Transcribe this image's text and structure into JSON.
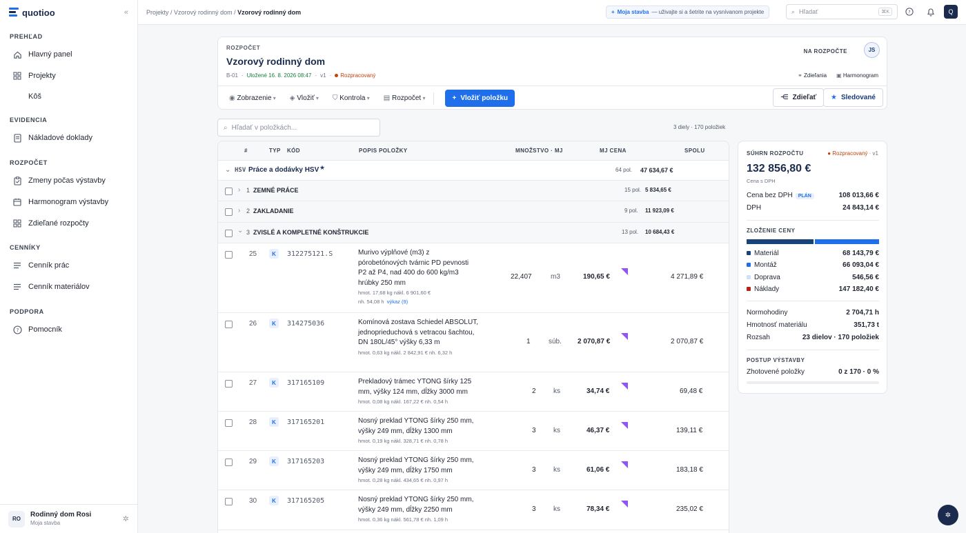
{
  "app": {
    "name": "quotioo"
  },
  "sidebar": {
    "sections": [
      {
        "title": "PREHĽAD",
        "items": [
          {
            "label": "Hlavný panel",
            "icon": "home-icon"
          },
          {
            "label": "Projekty",
            "icon": "grid-icon"
          },
          {
            "label": "Kôš",
            "icon": ""
          }
        ]
      },
      {
        "title": "EVIDENCIA",
        "items": [
          {
            "label": "Nákladové doklady",
            "icon": "document-icon"
          }
        ]
      },
      {
        "title": "ROZPOČET",
        "items": [
          {
            "label": "Zmeny počas výstavby",
            "icon": "clipboard-icon"
          },
          {
            "label": "Harmonogram výstavby",
            "icon": "calendar-icon"
          },
          {
            "label": "Zdieľané rozpočty",
            "icon": "grid-icon"
          }
        ]
      },
      {
        "title": "CENNÍKY",
        "items": [
          {
            "label": "Cenník prác",
            "icon": "list-icon"
          },
          {
            "label": "Cenník materiálov",
            "icon": "list-icon"
          }
        ]
      },
      {
        "title": "PODPORA",
        "items": [
          {
            "label": "Pomocník",
            "icon": "help-icon"
          }
        ]
      }
    ],
    "user": {
      "initials": "RO",
      "name": "Rodinný dom Rosi",
      "subtitle": "Moja stavba"
    }
  },
  "topbar": {
    "breadcrumb": [
      "Projekty",
      "Vzorový rodinný dom",
      "Vzorový rodinný dom"
    ],
    "promo_title": "Moja stavba",
    "promo_text": "— uživajte si a šetrite na vysnívanom projekte",
    "search_placeholder": "Hľadať",
    "search_kbd": "⌘K",
    "user_initial": "Q"
  },
  "header": {
    "kicker": "ROZPOČET",
    "title": "Vzorový rodinný dom",
    "code": "B-01",
    "saved": "Uložené 16. 8. 2026 08:47",
    "version": "v1",
    "status": "Rozpracovaný",
    "owner_label": "NA ROZPOČTE",
    "owner_initials": "JS",
    "link_share": "Zdieľania",
    "link_schedule": "Harmonogram",
    "tools": [
      "Zobrazenie",
      "Vložiť",
      "Kontrola",
      "Rozpočet"
    ],
    "add_item": "Vložiť položku",
    "share": "Zdieľať",
    "follow": "Sledované"
  },
  "items_search": {
    "placeholder": "Hľadať v položkách...",
    "counts": "3 diely · 170 položiek"
  },
  "table": {
    "columns": {
      "num": "#",
      "type": "TYP",
      "code": "KÓD",
      "desc": "POPIS POLOŽKY",
      "qty": "MNOŽSTVO · MJ",
      "unit_price": "MJ CENA",
      "total": "SPOLU"
    },
    "group": {
      "code": "HSV",
      "name": "Práce a dodávky HSV",
      "count": "64 pol.",
      "total": "47 634,67 €"
    },
    "sections": [
      {
        "num": "1",
        "name": "ZEMNÉ PRÁCE",
        "count": "15 pol.",
        "total": "5 834,65 €"
      },
      {
        "num": "2",
        "name": "ZAKLADANIE",
        "count": "9 pol.",
        "total": "11 923,09 €"
      },
      {
        "num": "3",
        "name": "ZVISLÉ A KOMPLETNÉ KONŠTRUKCIE",
        "count": "13 pol.",
        "total": "10 684,43 €"
      }
    ],
    "items": [
      {
        "n": "25",
        "type": "K",
        "code": "312275121.S",
        "desc": "Murivo výplňové (m3) z pórobetónových tvárnic PD pevnosti P2 až P4, nad 400 do 600 kg/m3 hrúbky 250 mm",
        "meta": "hmot. 17,68 kg   nákl. 6 901,60 €",
        "meta2": "nh. 54,08 h",
        "link": "výkaz (9)",
        "qty": "22,407",
        "unit": "m3",
        "price": "190,65 €",
        "total": "4 271,89 €"
      },
      {
        "n": "26",
        "type": "K",
        "code": "314275036",
        "desc": "Komínová zostava Schiedel ABSOLUT, jednoprieduchová s vetracou šachtou, DN 180L/45° výšky 6,33 m",
        "meta": "hmot. 0,63 kg   nákl. 2 842,91 €   nh. 6,32 h",
        "meta2": "",
        "link": "",
        "qty": "1",
        "unit": "súb.",
        "price": "2 070,87 €",
        "total": "2 070,87 €"
      },
      {
        "n": "27",
        "type": "K",
        "code": "317165109",
        "desc": "Prekladový trámec YTONG šírky 125 mm, výšky 124 mm, dĺžky 3000 mm",
        "meta": "hmot. 0,08 kg   nákl. 167,22 €   nh. 0,54 h",
        "meta2": "",
        "link": "",
        "qty": "2",
        "unit": "ks",
        "price": "34,74 €",
        "total": "69,48 €"
      },
      {
        "n": "28",
        "type": "K",
        "code": "317165201",
        "desc": "Nosný preklad YTONG šírky 250 mm, výšky 249 mm, dĺžky 1300 mm",
        "meta": "hmot. 0,19 kg   nákl. 328,71 €   nh. 0,78 h",
        "meta2": "",
        "link": "",
        "qty": "3",
        "unit": "ks",
        "price": "46,37 €",
        "total": "139,11 €"
      },
      {
        "n": "29",
        "type": "K",
        "code": "317165203",
        "desc": "Nosný preklad YTONG šírky 250 mm, výšky 249 mm, dĺžky 1750 mm",
        "meta": "hmot. 0,28 kg   nákl. 434,65 €   nh. 0,97 h",
        "meta2": "",
        "link": "",
        "qty": "3",
        "unit": "ks",
        "price": "61,06 €",
        "total": "183,18 €"
      },
      {
        "n": "30",
        "type": "K",
        "code": "317165205",
        "desc": "Nosný preklad YTONG šírky 250 mm, výšky 249 mm, dĺžky 2250 mm",
        "meta": "hmot. 0,36 kg   nákl. 561,78 €   nh. 1,09 h",
        "meta2": "",
        "link": "",
        "qty": "3",
        "unit": "ks",
        "price": "78,34 €",
        "total": "235,02 €"
      }
    ]
  },
  "summary": {
    "title": "SÚHRN ROZPOČTU",
    "status": "Rozpracovaný",
    "version": "v1",
    "total": "132 856,80 €",
    "total_sub": "Cena s DPH",
    "net_label": "Cena bez DPH",
    "plan_badge": "PLÁN",
    "net": "108 013,66 €",
    "vat_label": "DPH",
    "vat": "24 843,14 €",
    "composition_title": "ZLOŽENIE CENY",
    "composition": [
      {
        "label": "Materiál",
        "value": "68 143,79 €",
        "color": "#17427a",
        "share": 0.51
      },
      {
        "label": "Montáž",
        "value": "66 093,04 €",
        "color": "#1f6feb",
        "share": 0.49
      },
      {
        "label": "Doprava",
        "value": "546,56 €",
        "color": "#cfe0fb",
        "share": 0.0
      },
      {
        "label": "Náklady",
        "value": "147 182,40 €",
        "color": "#b42318",
        "share": 0.0
      }
    ],
    "stats": [
      {
        "label": "Normohodiny",
        "value": "2 704,71 h"
      },
      {
        "label": "Hmotnosť materiálu",
        "value": "351,73 t"
      },
      {
        "label": "Rozsah",
        "value": "23 dielov · 170 položiek"
      }
    ],
    "progress_title": "POSTUP VÝSTAVBY",
    "progress_label": "Zhotovené položky",
    "progress_value": "0 z 170 · 0 %",
    "progress_fraction": 0
  }
}
